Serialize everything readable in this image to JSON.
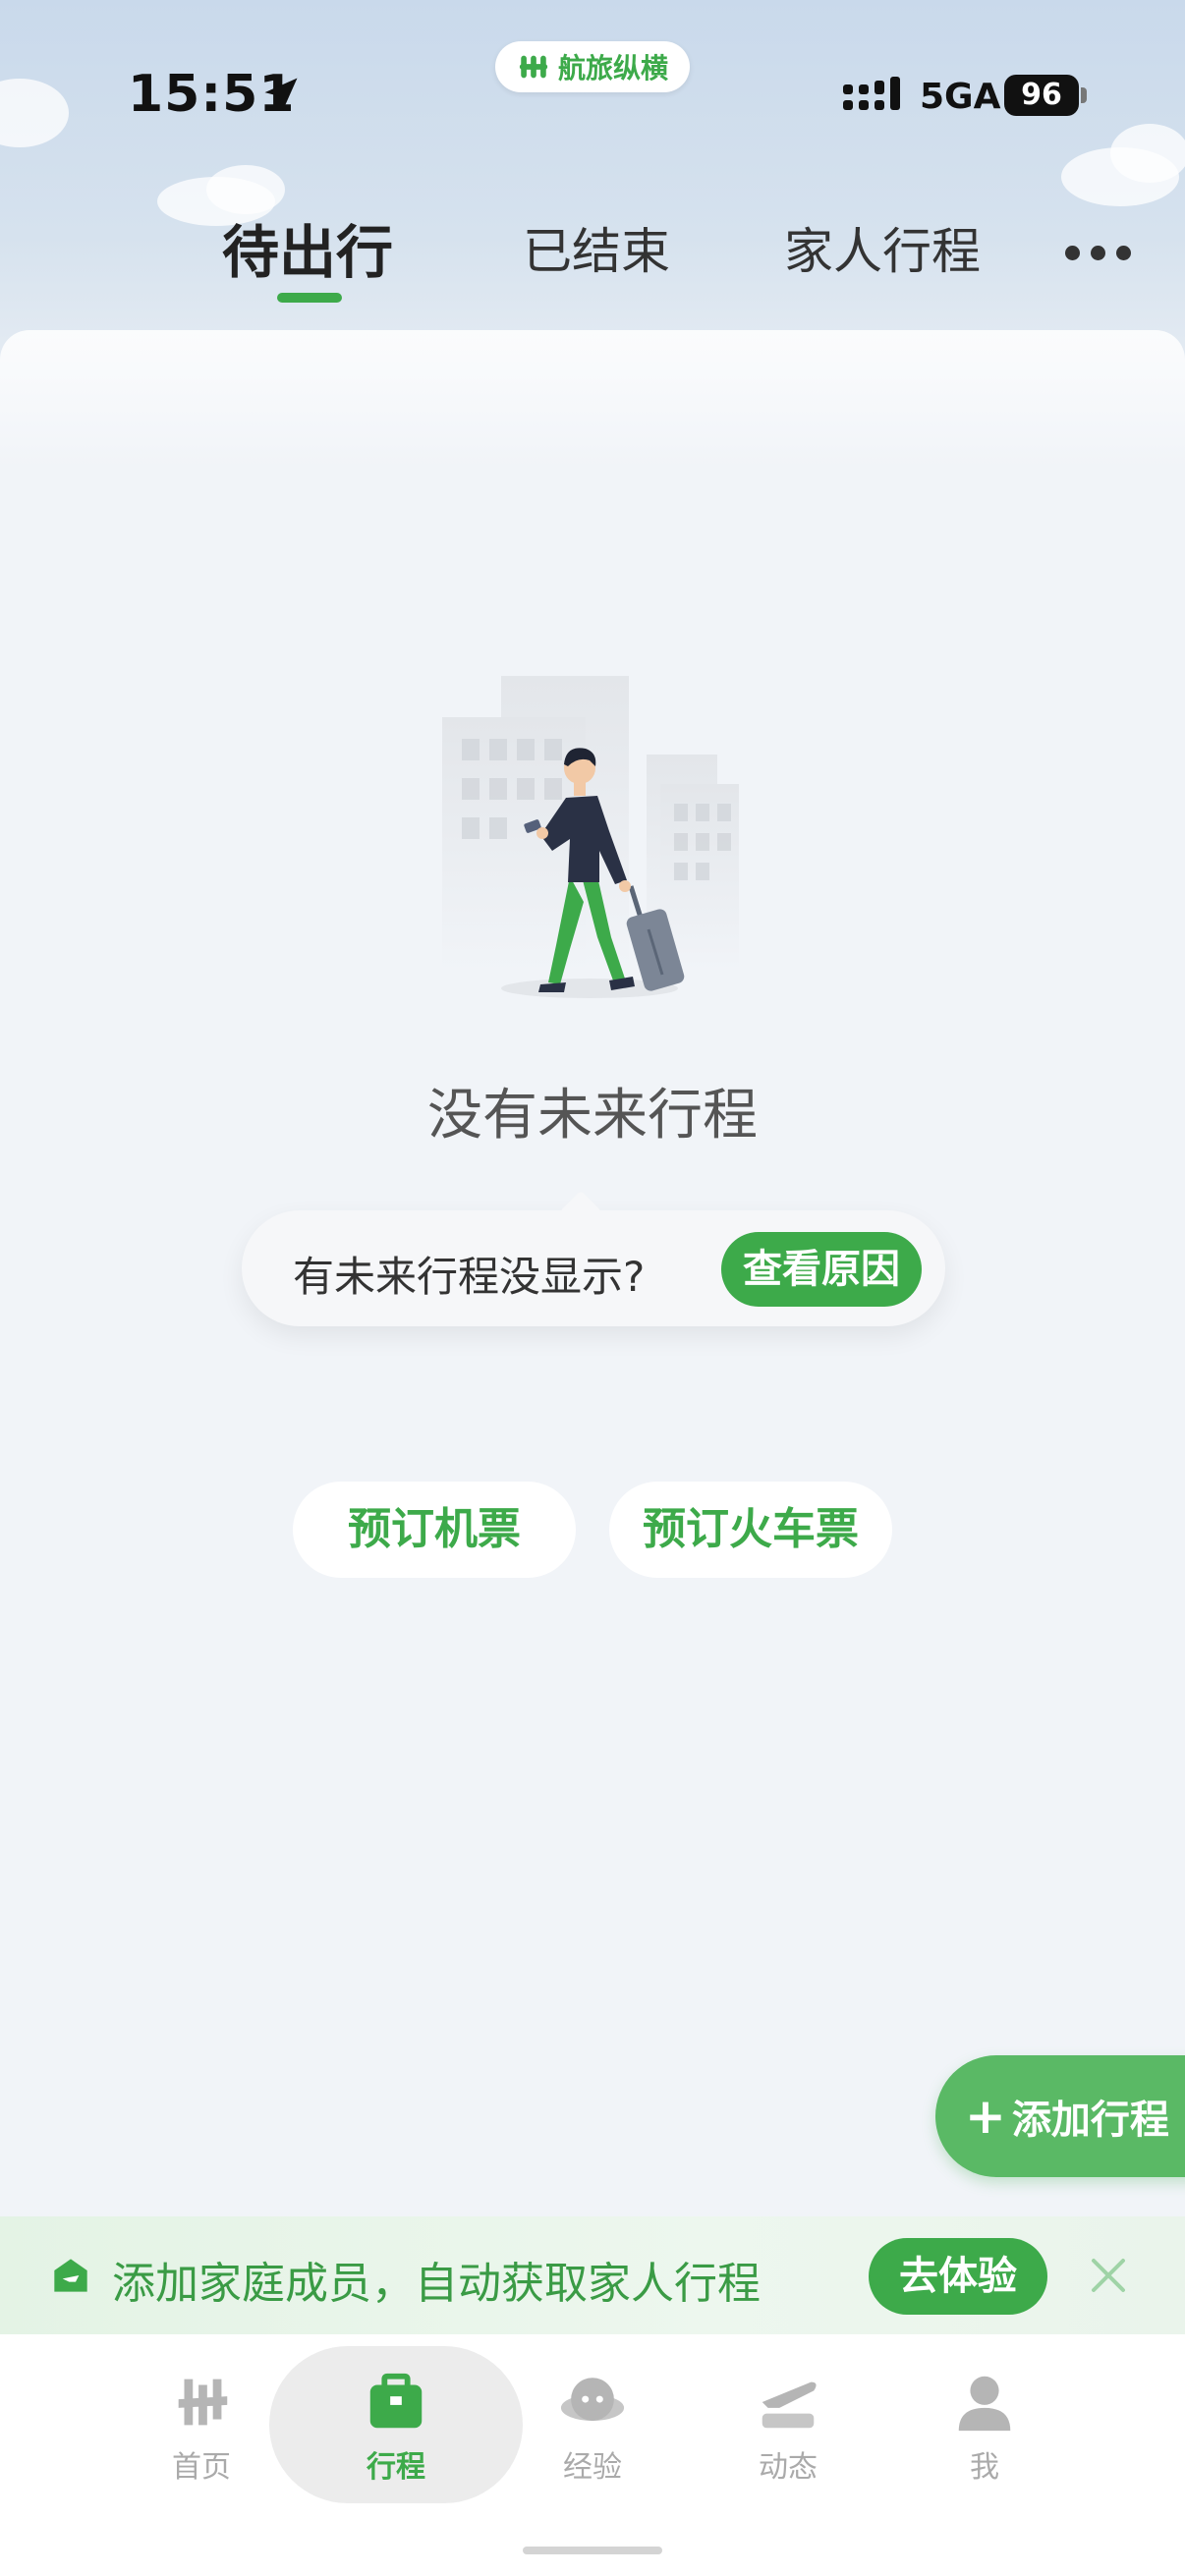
{
  "status_bar": {
    "time": "15:51",
    "brand": "航旅纵横",
    "network": "5GA",
    "battery": "96"
  },
  "tabs": [
    {
      "label": "待出行",
      "active": true
    },
    {
      "label": "已结束",
      "active": false
    },
    {
      "label": "家人行程",
      "active": false
    }
  ],
  "empty_state": {
    "title": "没有未来行程",
    "hint_text": "有未来行程没显示?",
    "hint_button": "查看原因"
  },
  "actions": {
    "book_flight": "预订机票",
    "book_train": "预订火车票",
    "add_trip": "添加行程"
  },
  "family_banner": {
    "text": "添加家庭成员，自动获取家人行程",
    "button": "去体验"
  },
  "bottom_nav": [
    {
      "label": "首页",
      "icon": "home-icon"
    },
    {
      "label": "行程",
      "icon": "suitcase-icon",
      "active": true
    },
    {
      "label": "经验",
      "icon": "planet-icon"
    },
    {
      "label": "动态",
      "icon": "flight-dynamic-icon"
    },
    {
      "label": "我",
      "icon": "profile-icon"
    }
  ],
  "colors": {
    "accent": "#3daa4a",
    "background": "#f1f4f8"
  }
}
